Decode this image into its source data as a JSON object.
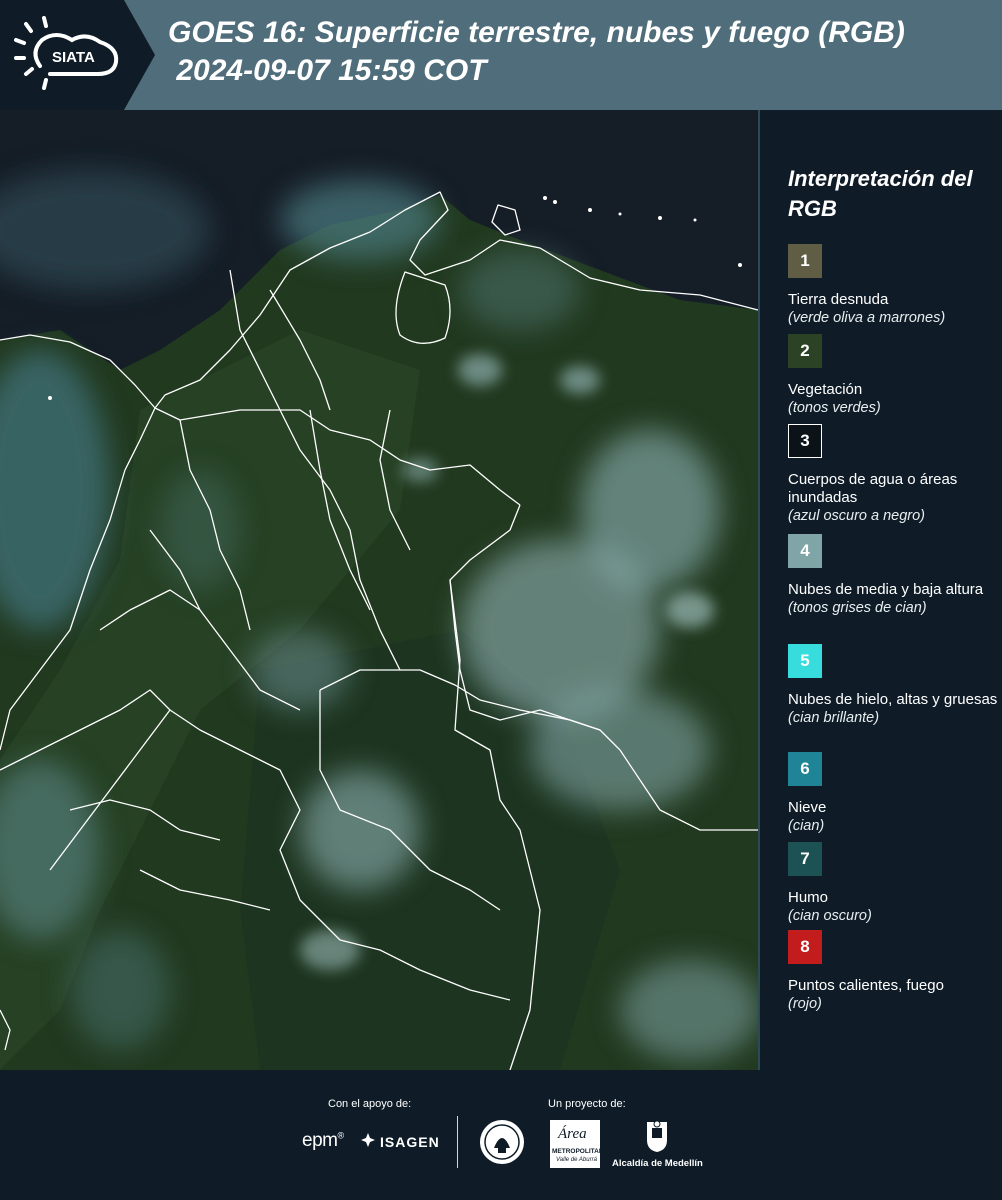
{
  "header": {
    "logo_text": "SIATA",
    "title": "GOES 16: Superficie terrestre, nubes y fuego (RGB)\n 2024-09-07 15:59 COT"
  },
  "legend": {
    "title": "Interpretación del RGB",
    "items": [
      {
        "number": "1",
        "label": "Tierra desnuda",
        "sub": "(verde oliva a marrones)",
        "color": "#5f5d43"
      },
      {
        "number": "2",
        "label": "Vegetación",
        "sub": "(tonos verdes)",
        "color": "#2b4224"
      },
      {
        "number": "3",
        "label": "Cuerpos de agua o áreas inundadas",
        "sub": "(azul oscuro a negro)",
        "color": "#0b1318"
      },
      {
        "number": "4",
        "label": "Nubes de media y baja altura",
        "sub": "(tonos grises de cian)",
        "color": "#7fa5a7"
      },
      {
        "number": "5",
        "label": "Nubes de hielo, altas y gruesas",
        "sub": "(cian brillante)",
        "color": "#37dcdc"
      },
      {
        "number": "6",
        "label": "Nieve",
        "sub": "(cian)",
        "color": "#1f8496"
      },
      {
        "number": "7",
        "label": "Humo",
        "sub": "(cian oscuro)",
        "color": "#1c5253"
      },
      {
        "number": "8",
        "label": "Puntos calientes, fuego",
        "sub": "(rojo)",
        "color": "#c21c1c"
      }
    ]
  },
  "footer": {
    "support_label": "Con el apoyo de:",
    "project_label": "Un proyecto de:",
    "epm": "epm",
    "isagen": "ISAGEN",
    "metropolitana": "METROPOLITANA",
    "valle": "Valle de Aburrá",
    "alcaldia": "Alcaldía de Medellín",
    "area": "Área"
  }
}
